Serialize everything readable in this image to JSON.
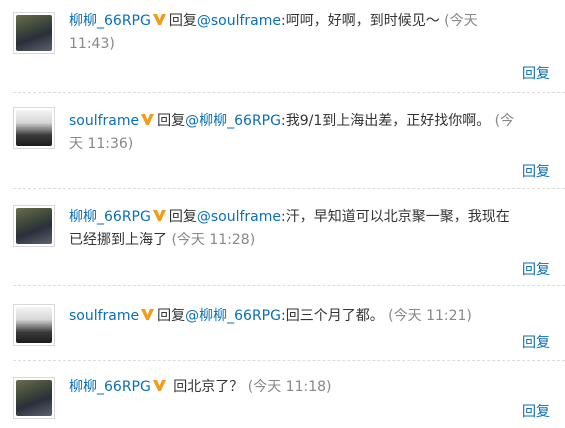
{
  "comments": [
    {
      "user": "柳柳_66RPG",
      "prefix": "回复",
      "mention": "@soulframe",
      "content": ":呵呵，好啊，到时候见～",
      "time_line1": " (今天",
      "time_line2": "11:43)",
      "reply_label": "回复"
    },
    {
      "user": "soulframe",
      "prefix": "回复",
      "mention": "@柳柳_66RPG",
      "content": ":我9/1到上海出差，正好找你啊。",
      "time_line1": " (今",
      "time_line2": "天 11:36)",
      "reply_label": "回复"
    },
    {
      "user": "柳柳_66RPG",
      "prefix": "回复",
      "mention": "@soulframe",
      "content": ":汗，早知道可以北京聚一聚，我现在",
      "content_line2": "已经挪到上海了",
      "time": " (今天 11:28)",
      "reply_label": "回复"
    },
    {
      "user": "soulframe",
      "prefix": "回复",
      "mention": "@柳柳_66RPG",
      "content": ":回三个月了都。",
      "time": " (今天 11:21)",
      "reply_label": "回复"
    },
    {
      "user": "柳柳_66RPG",
      "content": " 回北京了？",
      "time": " (今天 11:18)",
      "reply_label": "回复"
    }
  ],
  "colors": {
    "link": "#0a6fb5",
    "text": "#333333",
    "time": "#888888",
    "badge": "#f39b1a"
  },
  "icons": {
    "verified_badge": "v-badge-icon"
  }
}
